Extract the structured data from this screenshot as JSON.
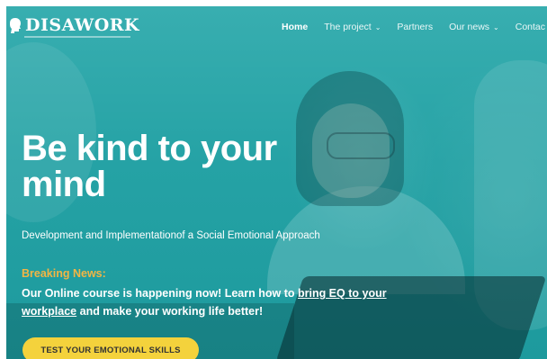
{
  "header": {
    "logo_text": "DISAWORK",
    "nav": [
      {
        "label": "Home",
        "has_dropdown": false,
        "active": true
      },
      {
        "label": "The project",
        "has_dropdown": true,
        "active": false
      },
      {
        "label": "Partners",
        "has_dropdown": false,
        "active": false
      },
      {
        "label": "Our news",
        "has_dropdown": true,
        "active": false
      },
      {
        "label": "Contac",
        "has_dropdown": false,
        "active": false
      }
    ]
  },
  "hero": {
    "headline": "Be kind to your mind",
    "subheadline": "Development and Implementationof a Social Emotional Approach",
    "breaking_label": "Breaking News:",
    "news_prefix": "Our Online course is happening now! Learn how to ",
    "news_link": "bring EQ to your workplace",
    "news_suffix": " and make your working life better!",
    "cta_label": "TEST YOUR EMOTIONAL SKILLS"
  },
  "colors": {
    "overlay": "#25a2a5",
    "accent_yellow": "#f4d23c",
    "breaking_orange": "#f2b544"
  }
}
